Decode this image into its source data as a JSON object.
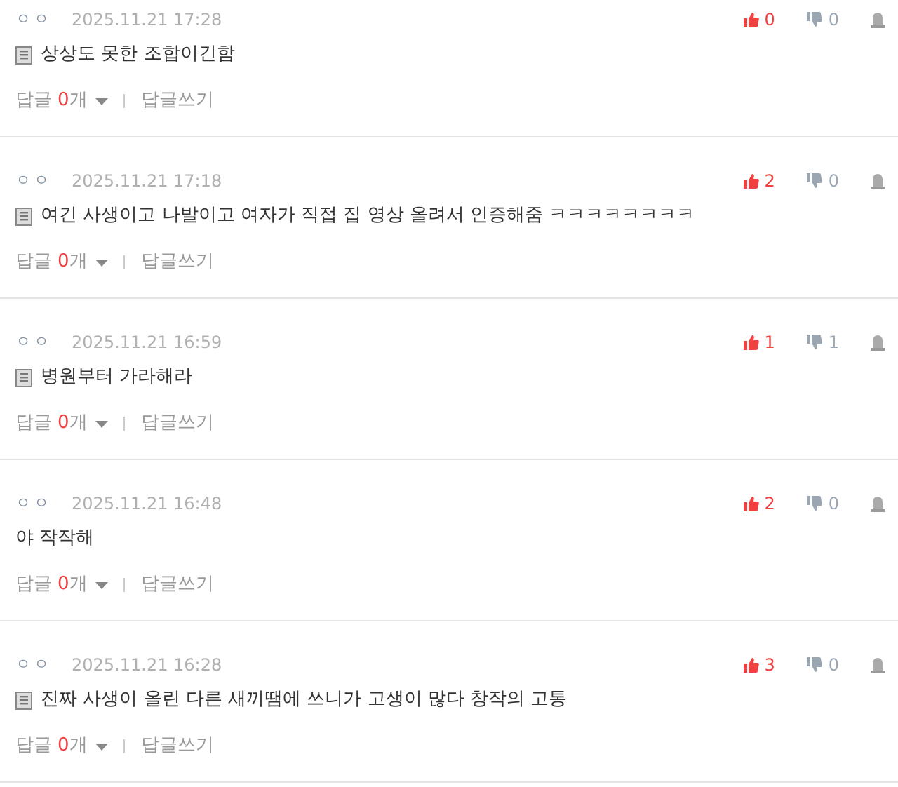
{
  "comments": [
    {
      "author": "ㅇㅇ",
      "date": "2025.11.21 17:28",
      "memo_icon": true,
      "text": "상상도 못한 조합이긴함",
      "likes": "0",
      "dislikes": "0",
      "reply_label": "답글",
      "reply_count": "0",
      "reply_unit": "개",
      "write_reply": "답글쓰기"
    },
    {
      "author": "ㅇㅇ",
      "date": "2025.11.21 17:18",
      "memo_icon": true,
      "text": "여긴 사생이고 나발이고 여자가 직접 집 영상 올려서 인증해줌 ㅋㅋㅋㅋㅋㅋㅋㅋ",
      "likes": "2",
      "dislikes": "0",
      "reply_label": "답글",
      "reply_count": "0",
      "reply_unit": "개",
      "write_reply": "답글쓰기"
    },
    {
      "author": "ㅇㅇ",
      "date": "2025.11.21 16:59",
      "memo_icon": true,
      "text": "병원부터 가라해라",
      "likes": "1",
      "dislikes": "1",
      "reply_label": "답글",
      "reply_count": "0",
      "reply_unit": "개",
      "write_reply": "답글쓰기"
    },
    {
      "author": "ㅇㅇ",
      "date": "2025.11.21 16:48",
      "memo_icon": false,
      "text": "야 작작해",
      "likes": "2",
      "dislikes": "0",
      "reply_label": "답글",
      "reply_count": "0",
      "reply_unit": "개",
      "write_reply": "답글쓰기"
    },
    {
      "author": "ㅇㅇ",
      "date": "2025.11.21 16:28",
      "memo_icon": true,
      "text": "진짜 사생이 올린 다른 새끼땜에 쓰니가 고생이 많다 창작의 고통",
      "likes": "3",
      "dislikes": "0",
      "reply_label": "답글",
      "reply_count": "0",
      "reply_unit": "개",
      "write_reply": "답글쓰기"
    }
  ]
}
